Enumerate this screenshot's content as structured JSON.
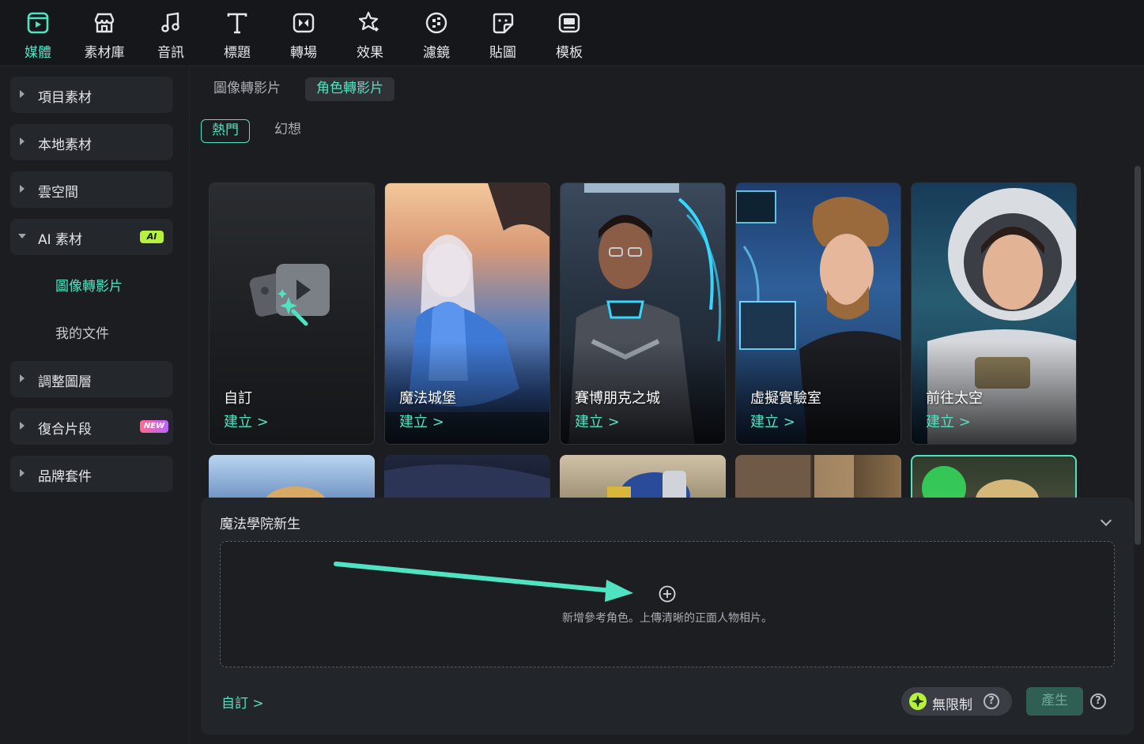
{
  "toolbar": {
    "items": [
      {
        "label": "媒體",
        "icon": "media-icon",
        "active": true
      },
      {
        "label": "素材庫",
        "icon": "store-icon",
        "active": false
      },
      {
        "label": "音訊",
        "icon": "music-note-icon",
        "active": false
      },
      {
        "label": "標題",
        "icon": "title-text-icon",
        "active": false
      },
      {
        "label": "轉場",
        "icon": "transition-icon",
        "active": false
      },
      {
        "label": "效果",
        "icon": "effects-star-icon",
        "active": false
      },
      {
        "label": "濾鏡",
        "icon": "filter-icon",
        "active": false
      },
      {
        "label": "貼圖",
        "icon": "sticker-icon",
        "active": false
      },
      {
        "label": "模板",
        "icon": "template-icon",
        "active": false
      }
    ]
  },
  "sidebar": {
    "items": [
      {
        "label": "項目素材"
      },
      {
        "label": "本地素材"
      },
      {
        "label": "雲空間"
      },
      {
        "label": "AI 素材",
        "badge": "AI",
        "expanded": true
      },
      {
        "label": "調整圖層"
      },
      {
        "label": "復合片段",
        "badge": "NEW"
      },
      {
        "label": "品牌套件"
      }
    ],
    "sub_items": [
      {
        "label": "圖像轉影片",
        "active": true
      },
      {
        "label": "我的文件",
        "active": false
      }
    ]
  },
  "tabs": {
    "primary": [
      {
        "label": "圖像轉影片",
        "active": false
      },
      {
        "label": "角色轉影片",
        "active": true
      }
    ],
    "secondary": [
      {
        "label": "熱門",
        "active": true
      },
      {
        "label": "幻想",
        "active": false
      }
    ]
  },
  "cards": [
    {
      "name": "自訂",
      "create": "建立 >"
    },
    {
      "name": "魔法城堡",
      "create": "建立 >"
    },
    {
      "name": "賽博朋克之城",
      "create": "建立 >"
    },
    {
      "name": "虛擬實驗室",
      "create": "建立 >"
    },
    {
      "name": "前往太空",
      "create": "建立 >"
    }
  ],
  "panel": {
    "title": "魔法學院新生",
    "upload_hint": "新增參考角色。上傳清晰的正面人物相片。",
    "custom_link": "自訂 >",
    "unlimited_label": "無限制",
    "help_symbol": "?",
    "generate_label": "產生"
  },
  "colors": {
    "accent": "#4fe3c1",
    "background": "#1b1d21",
    "panel": "#22252a"
  }
}
